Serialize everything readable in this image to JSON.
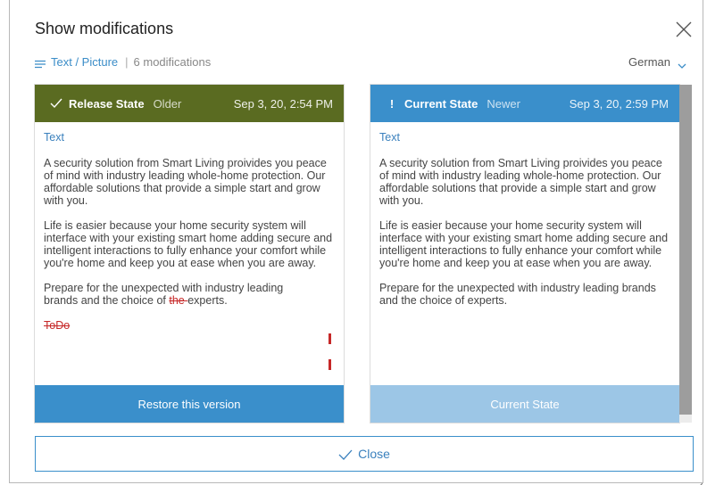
{
  "dialog": {
    "title": "Show modifications",
    "category": "Text / Picture",
    "separator": "|",
    "modifications": "6 modifications",
    "language": "German",
    "close_label": "Close"
  },
  "release": {
    "name": "Release State",
    "age": "Older",
    "time": "Sep 3, 20, 2:54 PM",
    "field": "Text",
    "p1": "A security solution from Smart Living proivides you peace of mind with industry leading whole-home protection. Our affordable solutions that provide a simple start and grow with you.",
    "p2": "Life is easier because your home security system will interface with your existing smart home adding secure and intelligent interactions to fully enhance your comfort while you're home and keep you at ease when you are away.",
    "p3_before": "Prepare for the unexpected with industry leading brands and the choice of ",
    "p3_deleted": "the ",
    "p3_after": "experts.",
    "todo_deleted": "ToDo",
    "button": "Restore this version"
  },
  "current": {
    "name": "Current State",
    "age": "Newer",
    "time": "Sep 3, 20, 2:59 PM",
    "field": "Text",
    "p1": "A security solution from Smart Living proivides you peace of mind with industry leading whole-home protection. Our affordable solutions that provide a simple start and grow with you.",
    "p2": "Life is easier because your home security system will interface with your existing smart home adding secure and intelligent interactions to fully enhance your comfort while you're home and keep you at ease when you are away.",
    "p3": "Prepare for the unexpected with industry leading brands and the choice of experts.",
    "button": "Current State",
    "badge": "!"
  },
  "colors": {
    "release_header": "#5a6b21",
    "current_header": "#3a8fcb",
    "restore_button": "#3a8fcb",
    "current_button": "#9cc6e6",
    "deleted_text": "#c62828",
    "link": "#3a80bd"
  },
  "icons": {
    "close": "close-icon",
    "lines": "text-lines-icon",
    "chevron": "chevron-down-icon",
    "check": "checkmark-icon",
    "exclamation": "exclamation-icon"
  }
}
